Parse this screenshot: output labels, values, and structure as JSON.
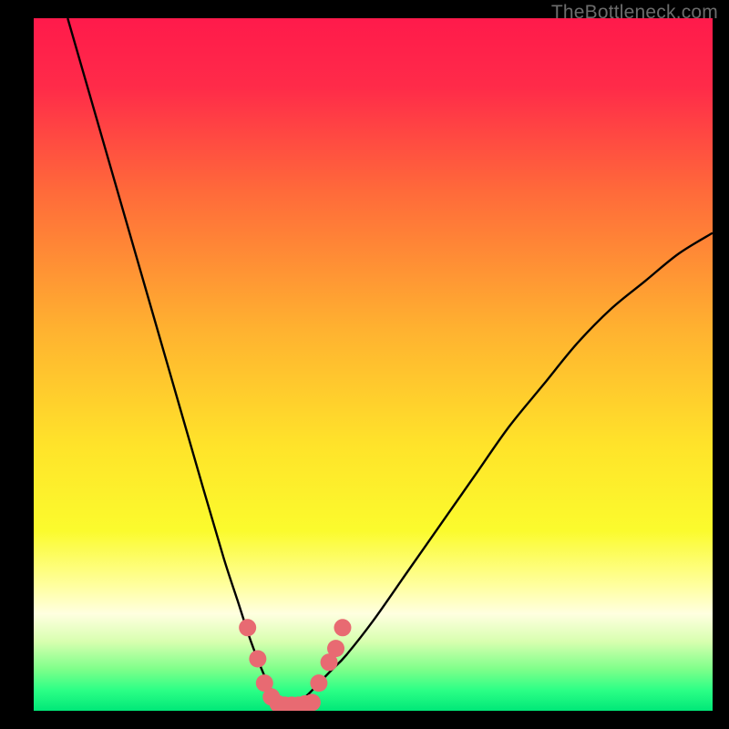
{
  "watermark": "TheBottleneck.com",
  "colors": {
    "gradient_stops": [
      {
        "offset": 0.0,
        "color": "#ff1a4b"
      },
      {
        "offset": 0.1,
        "color": "#ff2b49"
      },
      {
        "offset": 0.25,
        "color": "#ff6a3a"
      },
      {
        "offset": 0.45,
        "color": "#ffb230"
      },
      {
        "offset": 0.62,
        "color": "#ffe42a"
      },
      {
        "offset": 0.74,
        "color": "#fbfb2d"
      },
      {
        "offset": 0.82,
        "color": "#ffffa0"
      },
      {
        "offset": 0.86,
        "color": "#ffffe0"
      },
      {
        "offset": 0.9,
        "color": "#d8ffb0"
      },
      {
        "offset": 0.94,
        "color": "#7eff8a"
      },
      {
        "offset": 0.97,
        "color": "#2dff86"
      },
      {
        "offset": 1.0,
        "color": "#00e878"
      }
    ],
    "curve": "#000000",
    "marker": "#e86a72",
    "background_frame": "#000000"
  },
  "chart_data": {
    "type": "line",
    "title": "",
    "xlabel": "",
    "ylabel": "",
    "xlim": [
      0,
      100
    ],
    "ylim": [
      0,
      100
    ],
    "x_apex": 37,
    "series": [
      {
        "name": "bottleneck-curve",
        "x": [
          5,
          10,
          15,
          20,
          25,
          28,
          30,
          32,
          34,
          35,
          36,
          37,
          38,
          40,
          42,
          44,
          46,
          50,
          55,
          60,
          65,
          70,
          75,
          80,
          85,
          90,
          95,
          100
        ],
        "y": [
          100,
          83,
          66,
          49,
          32,
          22,
          16,
          10,
          5,
          3,
          1,
          0,
          1,
          2,
          4,
          6,
          8,
          13,
          20,
          27,
          34,
          41,
          47,
          53,
          58,
          62,
          66,
          69
        ]
      }
    ],
    "markers": {
      "name": "highlight-points",
      "x": [
        31.5,
        33.0,
        34.0,
        35.0,
        36.0,
        37.0,
        38.0,
        39.0,
        40.0,
        41.0,
        42.0,
        43.5,
        44.5,
        45.5
      ],
      "y": [
        12.0,
        7.5,
        4.0,
        2.0,
        1.0,
        0.8,
        0.8,
        0.8,
        1.0,
        1.2,
        4.0,
        7.0,
        9.0,
        12.0
      ]
    }
  }
}
